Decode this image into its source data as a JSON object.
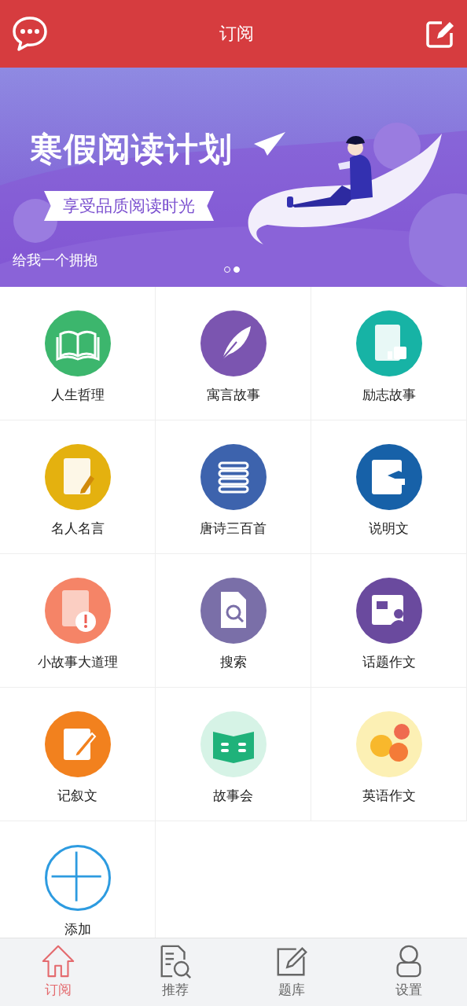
{
  "header": {
    "title": "订阅"
  },
  "banner": {
    "headline": "寒假阅读计划",
    "tagline": "享受品质阅读时光",
    "caption": "给我一个拥抱",
    "dots": [
      {
        "selected": false
      },
      {
        "selected": true
      }
    ]
  },
  "categories": [
    {
      "label": "人生哲理",
      "color": "#3cb66d"
    },
    {
      "label": "寓言故事",
      "color": "#7b55b0"
    },
    {
      "label": "励志故事",
      "color": "#17b3a5"
    },
    {
      "label": "名人名言",
      "color": "#e4b10f"
    },
    {
      "label": "唐诗三百首",
      "color": "#3d63ad"
    },
    {
      "label": "说明文",
      "color": "#1761a8"
    },
    {
      "label": "小故事大道理",
      "color": "#f58467"
    },
    {
      "label": "搜索",
      "color": "#7a6fa8"
    },
    {
      "label": "话题作文",
      "color": "#6a4a9e"
    },
    {
      "label": "记叙文",
      "color": "#f2811e"
    },
    {
      "label": "故事会",
      "color": "#d6f3e6"
    },
    {
      "label": "英语作文",
      "color": "#fcf0b4"
    },
    {
      "label": "添加",
      "color": "#2d9be0"
    }
  ],
  "tabbar": [
    {
      "label": "订阅",
      "selected": true
    },
    {
      "label": "推荐",
      "selected": false
    },
    {
      "label": "题库",
      "selected": false
    },
    {
      "label": "设置",
      "selected": false
    }
  ]
}
